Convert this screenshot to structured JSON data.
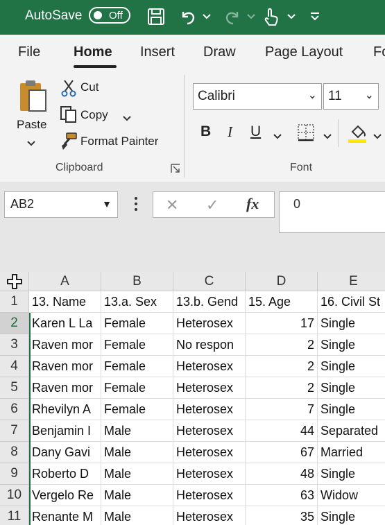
{
  "titlebar": {
    "autosave_label": "AutoSave",
    "autosave_state": "Off",
    "accent_color": "#217346",
    "icons": [
      "save-icon",
      "undo-icon",
      "redo-icon",
      "touch-mode-icon",
      "customize-qat-icon"
    ]
  },
  "menu": {
    "tabs": [
      "File",
      "Home",
      "Insert",
      "Draw",
      "Page Layout",
      "Fo"
    ],
    "active": "Home"
  },
  "ribbon": {
    "clipboard": {
      "paste_label": "Paste",
      "cut_label": "Cut",
      "copy_label": "Copy",
      "format_painter_label": "Format Painter",
      "group_label": "Clipboard"
    },
    "font": {
      "font_name": "Calibri",
      "font_size": "11",
      "bold": "B",
      "italic": "I",
      "underline": "U",
      "group_label": "Font"
    }
  },
  "formula_bar": {
    "name_box": "AB2",
    "fx_label": "fx",
    "cancel_glyph": "✕",
    "enter_glyph": "✓",
    "value": "0"
  },
  "grid": {
    "columns": [
      "A",
      "B",
      "C",
      "D",
      "E"
    ],
    "selected_row": "2",
    "rows": [
      {
        "num": "1",
        "cells": [
          "13. Name",
          "13.a. Sex",
          "13.b. Gend",
          "15. Age",
          "16. Civil St"
        ]
      },
      {
        "num": "2",
        "cells": [
          "Karen L La",
          "Female",
          "Heterosex",
          "17",
          "Single"
        ]
      },
      {
        "num": "3",
        "cells": [
          "Raven mor",
          "Female",
          "No respon",
          "2",
          "Single"
        ]
      },
      {
        "num": "4",
        "cells": [
          "Raven mor",
          "Female",
          "Heterosex",
          "2",
          "Single"
        ]
      },
      {
        "num": "5",
        "cells": [
          "Raven mor",
          "Female",
          "Heterosex",
          "2",
          "Single"
        ]
      },
      {
        "num": "6",
        "cells": [
          "Rhevilyn A",
          "Female",
          "Heterosex",
          "7",
          "Single"
        ]
      },
      {
        "num": "7",
        "cells": [
          "Benjamin I",
          "Male",
          "Heterosex",
          "44",
          "Separated"
        ]
      },
      {
        "num": "8",
        "cells": [
          "Dany Gavi",
          "Male",
          "Heterosex",
          "67",
          "Married"
        ]
      },
      {
        "num": "9",
        "cells": [
          "Roberto D",
          "Male",
          "Heterosex",
          "48",
          "Single"
        ]
      },
      {
        "num": "10",
        "cells": [
          "Vergelo Re",
          "Male",
          "Heterosex",
          "63",
          "Widow"
        ]
      },
      {
        "num": "11",
        "cells": [
          "Renante M",
          "Male",
          "Heterosex",
          "35",
          "Single"
        ]
      }
    ]
  }
}
